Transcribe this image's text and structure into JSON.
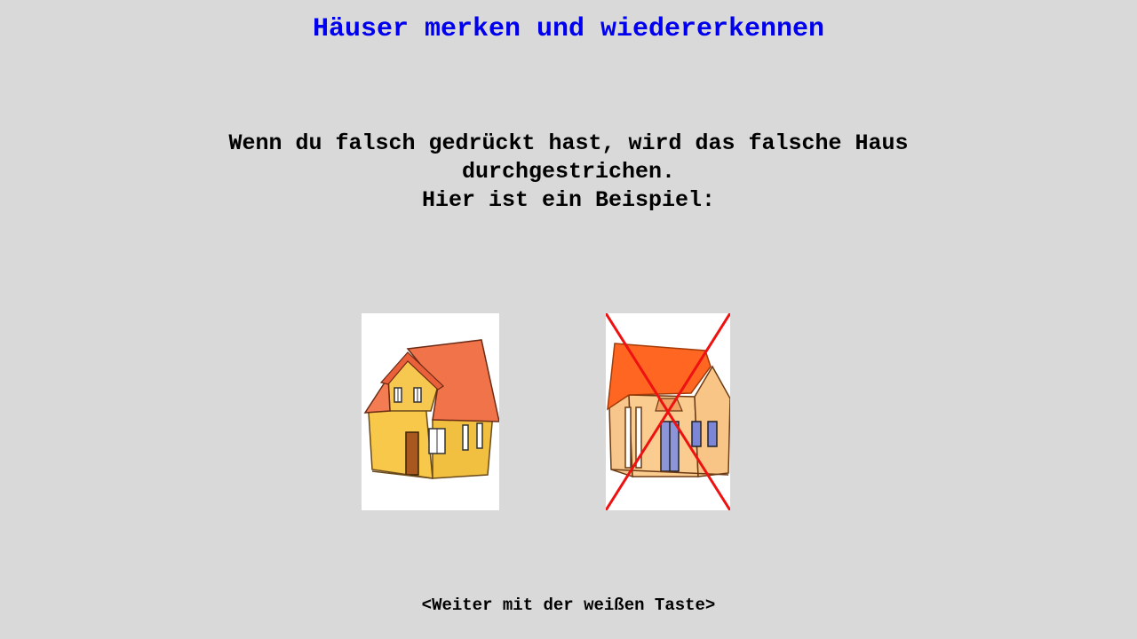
{
  "title": "Häuser merken und wiedererkennen",
  "instructions": {
    "line1": "Wenn du falsch gedrückt hast, wird das falsche Haus",
    "line2": "durchgestrichen.",
    "line3": "Hier ist ein Beispiel:"
  },
  "examples": [
    {
      "icon": "house-icon",
      "marked_wrong": false
    },
    {
      "icon": "house-icon",
      "marked_wrong": true,
      "mark_icon": "cross-out-icon"
    }
  ],
  "footer": {
    "continue_hint": "<Weiter mit der weißen Taste>"
  },
  "colors": {
    "background": "#d9d9d9",
    "title": "#0000ee",
    "text": "#000000",
    "cross": "#ee1111"
  }
}
